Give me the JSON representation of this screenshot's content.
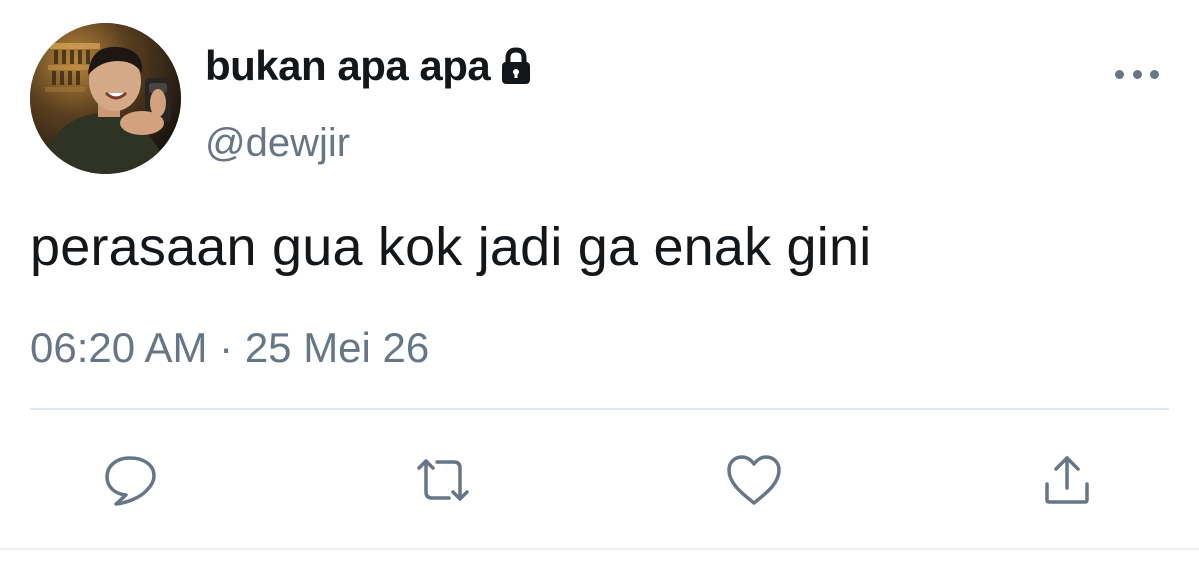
{
  "tweet": {
    "display_name": "bukan apa apa",
    "handle": "@dewjir",
    "text": "perasaan gua kok jadi ga enak gini",
    "time": "06:20 AM",
    "separator": "·",
    "date": "25 Mei 26"
  },
  "icons": {
    "protected": "lock-icon",
    "more": "more-horizontal-icon",
    "reply": "reply-bubble-icon",
    "retweet": "retweet-icon",
    "like": "heart-icon",
    "share": "share-upload-icon"
  },
  "colors": {
    "text": "#14171a",
    "secondary": "#657786",
    "divider": "#e1e8ed",
    "background": "#ffffff"
  }
}
